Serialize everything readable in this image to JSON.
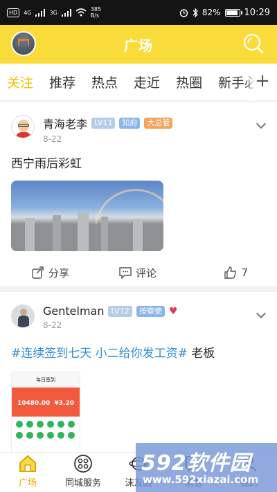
{
  "status_bar": {
    "network_badge": "HD",
    "signal_1": "4G",
    "signal_2": "3G",
    "net_speed_value": "385",
    "net_speed_unit": "B/s",
    "battery": "82%",
    "time": "10:29"
  },
  "header": {
    "title": "广场"
  },
  "tabs": [
    "关注",
    "推荐",
    "热点",
    "走近",
    "热圈",
    "新手必"
  ],
  "active_tab": "关注",
  "posts": [
    {
      "user": "青海老李",
      "badges": [
        "LV11",
        "知府",
        "大总管"
      ],
      "date": "8-22",
      "text": "西宁雨后彩虹",
      "share_label": "分享",
      "comment_label": "评论",
      "likes": "7"
    },
    {
      "user": "Gentelman",
      "badges": [
        "LV12",
        "按察使"
      ],
      "date": "8-22",
      "tag": "#连续签到七天 小二给你发工资#",
      "text": " 老板",
      "thumb": {
        "title": "每日签到",
        "amount_1": "10480.00",
        "amount_2": "¥3.20"
      }
    }
  ],
  "bottom_nav": [
    "广场",
    "同城服务",
    "沫友圈",
    "消息",
    "我的"
  ],
  "watermark": {
    "brand": "592软件园",
    "url": "www.592xiazai.com"
  },
  "colors": {
    "accent": "#f9db3a",
    "active_tab": "#f2c200",
    "tag_blue": "#2e8ad8",
    "heart": "#e03a56"
  }
}
